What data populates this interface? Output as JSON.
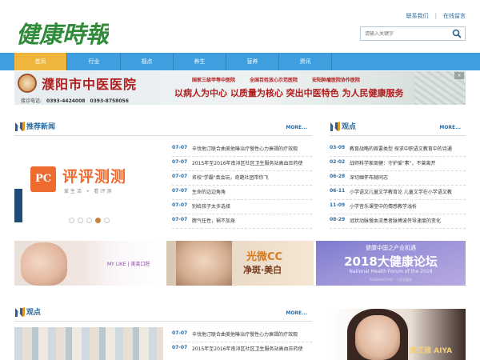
{
  "header": {
    "logo_text": "健康時報",
    "links": [
      "联系我们",
      "在线留言"
    ],
    "search_placeholder": "请输入关键字"
  },
  "nav": {
    "items": [
      "首页",
      "行业",
      "视点",
      "养生",
      "营养",
      "资讯"
    ],
    "active_index": 0
  },
  "hospital_banner": {
    "name": "濮阳市中医医院",
    "phone_label": "接诊电话:",
    "phones": [
      "0393-4424008",
      "0393-8758056"
    ],
    "badges": [
      "国家三级甲等中医院",
      "全国百姓放心示范医院",
      "安阳肿瘤医院协作医院"
    ],
    "slogan": "以病人为中心  以质量为核心  突出中医特色  为人民健康服务"
  },
  "recommended": {
    "title": "推荐新闻",
    "more": "MORE...",
    "items": [
      {
        "date": "07-07",
        "text": "辛伐他汀联合曲美他嗪治疗慢性心力衰竭的疗效观"
      },
      {
        "date": "07-07",
        "text": "2015年至2016年南浔区社区卫生服务站高血压药使"
      },
      {
        "date": "07-07",
        "text": "名校\"学霸\"真会玩，奇葩社团带你飞"
      },
      {
        "date": "07-07",
        "text": "生命的边边角角"
      },
      {
        "date": "07-07",
        "text": "别给孩子太多选择"
      },
      {
        "date": "07-07",
        "text": "脾气任性，祸不加身"
      }
    ]
  },
  "slider": {
    "brand_mark": "PC",
    "title": "评评测测",
    "subtitle": "爱生活 • 看评测",
    "dot_count": 5,
    "active_dot": 3
  },
  "viewpoint": {
    "title": "观点",
    "more": "MORE...",
    "items": [
      {
        "date": "03-09",
        "text": "教育战略的首要类型 探求中职语文教育中的诗通"
      },
      {
        "date": "02-02",
        "text": "战师科学家周健：守护爱\"素\"，不曾离开"
      },
      {
        "date": "06-28",
        "text": "深切缅怀布赫同志"
      },
      {
        "date": "06-11",
        "text": "小学语文儿童文学教育论 儿童文学在小学语文教"
      },
      {
        "date": "11-09",
        "text": "小学音乐课堂中的情感教学浅析"
      },
      {
        "date": "08-29",
        "text": "冠状动脉慢血流患者脉搏波传导速度的变化"
      }
    ]
  },
  "promos": {
    "p1_brand": "MY LIKE | 美莱口腔",
    "p2_line1": "光微CC",
    "p2_line2": "净斑·美白",
    "p3_line1": "健康中国之产业机遇",
    "p3_line2": "2018大健康论坛",
    "p3_line3": "National Health Forum of the 2018",
    "p3_line4": "2018年4月19日 · 人民日报社"
  },
  "viewpoint2": {
    "title": "观点",
    "more": "MORE...",
    "items": [
      {
        "date": "07-07",
        "text": "辛伐他汀联合曲美他嗪治疗慢性心力衰竭的疗效观"
      },
      {
        "date": "07-07",
        "text": "2015年至2016年南浔区社区卫生服务站高血压药使"
      }
    ]
  },
  "bottom_ad": {
    "text": "来艾雅 AIYA"
  },
  "colors": {
    "nav_blue": "#3f9fde",
    "nav_active": "#f0b53c",
    "link_blue": "#2a6ea5",
    "logo_green": "#2f8a3a",
    "banner_red": "#b01e1e"
  },
  "icons": [
    "search-icon",
    "section-n-icon"
  ]
}
